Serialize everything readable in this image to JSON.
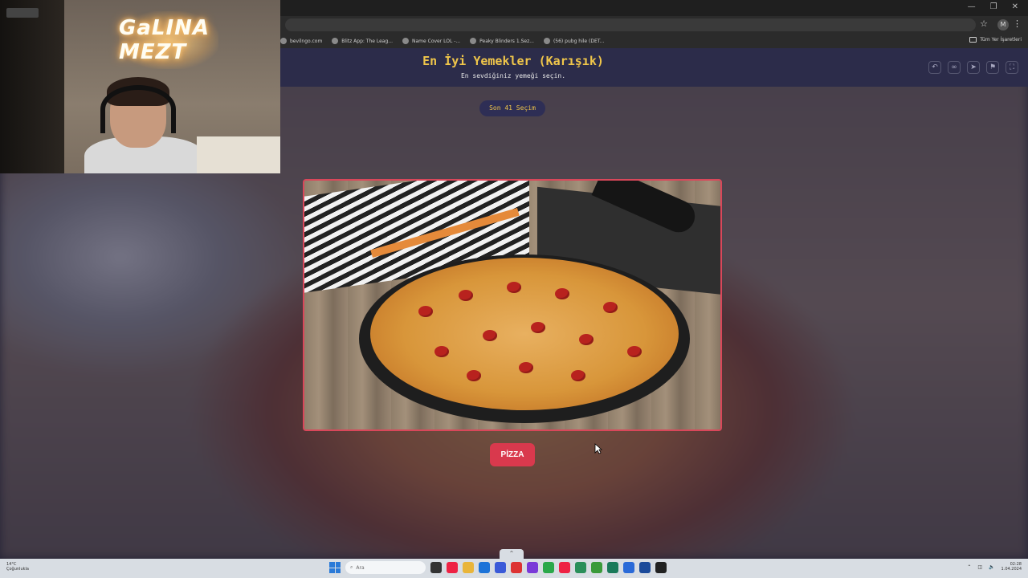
{
  "webcam": {
    "neon_text": "GaLINA MEZT"
  },
  "browser": {
    "bookmarks": [
      {
        "label": "bevilngo.com"
      },
      {
        "label": "Blitz App: The Leag..."
      },
      {
        "label": "Name Cover LOL -..."
      },
      {
        "label": "Peaky Blinders 1.Sez..."
      },
      {
        "label": "(56) pubg hile (DET..."
      }
    ],
    "bookmarks_folder": "Tüm Yer İşaretleri",
    "profile_initial": "M"
  },
  "page": {
    "title": "En İyi Yemekler (Karışık)",
    "subtitle": "En sevdiğiniz yemeği seçin.",
    "round_pill": "Son 41 Seçim",
    "choice_label": "PİZZA",
    "header_icons": [
      "undo-icon",
      "link-icon",
      "share-icon",
      "flag-icon",
      "fullscreen-icon"
    ]
  },
  "taskbar": {
    "weather_temp": "14°C",
    "weather_desc": "Çoğunlukla",
    "search_placeholder": "Ara",
    "time": "02:28",
    "date": "1.04.2024"
  },
  "colors": {
    "accent_red": "#d9394d",
    "title_gold": "#f0c64a",
    "header_bg": "#2c2c4a"
  }
}
